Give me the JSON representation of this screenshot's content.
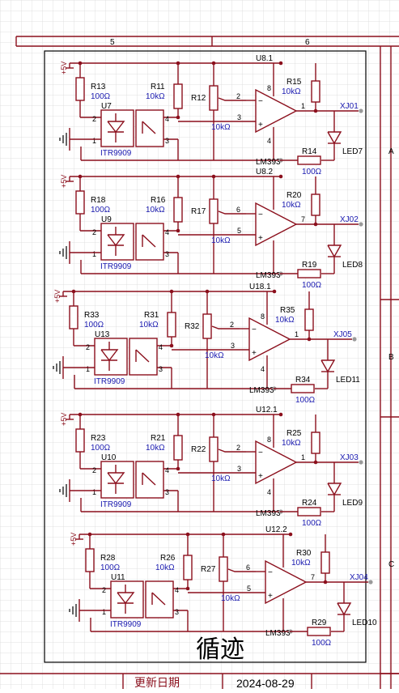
{
  "title_block": {
    "zone_5": "5",
    "zone_6": "6",
    "row_a": "A",
    "row_b": "B",
    "row_c": "C",
    "sheet_title": "循迹",
    "update_label": "更新日期",
    "update_date": "2024-08-29"
  },
  "colors": {
    "wire": "#8b0f1c",
    "value": "#1a1ab0",
    "grid": "#d7d7d7"
  },
  "channels": [
    {
      "supply": "+5V",
      "r_led": "R13",
      "r_led_val": "100Ω",
      "sensor": "U7",
      "sensor_part": "ITR9909",
      "r_pull": "R11",
      "r_pull_val": "10kΩ",
      "pot": "R12",
      "pot_val": "10kΩ",
      "comp": "U8.1",
      "comp_part": "LM393",
      "pin_minus": "2",
      "pin_plus": "3",
      "pin_out": "1",
      "pin_vcc": "8",
      "pin_gnd": "4",
      "r_out": "R15",
      "r_out_val": "10kΩ",
      "net": "XJ01",
      "r_ind": "R14",
      "r_ind_val": "100Ω",
      "led": "LED7",
      "pin_sa": "2",
      "pin_sb": "1",
      "pin_sc": "4",
      "pin_sd": "3"
    },
    {
      "supply": "+5V",
      "r_led": "R18",
      "r_led_val": "100Ω",
      "sensor": "U9",
      "sensor_part": "ITR9909",
      "r_pull": "R16",
      "r_pull_val": "10kΩ",
      "pot": "R17",
      "pot_val": "10kΩ",
      "comp": "U8.2",
      "comp_part": "LM393",
      "pin_minus": "6",
      "pin_plus": "5",
      "pin_out": "7",
      "pin_vcc": "",
      "pin_gnd": "",
      "r_out": "R20",
      "r_out_val": "10kΩ",
      "net": "XJ02",
      "r_ind": "R19",
      "r_ind_val": "100Ω",
      "led": "LED8",
      "pin_sa": "2",
      "pin_sb": "1",
      "pin_sc": "4",
      "pin_sd": "3"
    },
    {
      "supply": "+5V",
      "r_led": "R33",
      "r_led_val": "100Ω",
      "sensor": "U13",
      "sensor_part": "ITR9909",
      "r_pull": "R31",
      "r_pull_val": "10kΩ",
      "pot": "R32",
      "pot_val": "10kΩ",
      "comp": "U18.1",
      "comp_part": "LM393",
      "pin_minus": "2",
      "pin_plus": "3",
      "pin_out": "1",
      "pin_vcc": "8",
      "pin_gnd": "4",
      "r_out": "R35",
      "r_out_val": "10kΩ",
      "net": "XJ05",
      "r_ind": "R34",
      "r_ind_val": "100Ω",
      "led": "LED11",
      "pin_sa": "2",
      "pin_sb": "1",
      "pin_sc": "4",
      "pin_sd": "3"
    },
    {
      "supply": "+5V",
      "r_led": "R23",
      "r_led_val": "100Ω",
      "sensor": "U10",
      "sensor_part": "ITR9909",
      "r_pull": "R21",
      "r_pull_val": "10kΩ",
      "pot": "R22",
      "pot_val": "10kΩ",
      "comp": "U12.1",
      "comp_part": "LM393",
      "pin_minus": "2",
      "pin_plus": "3",
      "pin_out": "1",
      "pin_vcc": "8",
      "pin_gnd": "4",
      "r_out": "R25",
      "r_out_val": "10kΩ",
      "net": "XJ03",
      "r_ind": "R24",
      "r_ind_val": "100Ω",
      "led": "LED9",
      "pin_sa": "2",
      "pin_sb": "1",
      "pin_sc": "4",
      "pin_sd": "3"
    },
    {
      "supply": "+5V",
      "r_led": "R28",
      "r_led_val": "100Ω",
      "sensor": "U11",
      "sensor_part": "ITR9909",
      "r_pull": "R26",
      "r_pull_val": "10kΩ",
      "pot": "R27",
      "pot_val": "10kΩ",
      "comp": "U12.2",
      "comp_part": "LM393",
      "pin_minus": "6",
      "pin_plus": "5",
      "pin_out": "7",
      "pin_vcc": "",
      "pin_gnd": "",
      "r_out": "R30",
      "r_out_val": "10kΩ",
      "net": "XJ04",
      "r_ind": "R29",
      "r_ind_val": "100Ω",
      "led": "LED10",
      "pin_sa": "2",
      "pin_sb": "1",
      "pin_sc": "4",
      "pin_sd": "3"
    }
  ]
}
